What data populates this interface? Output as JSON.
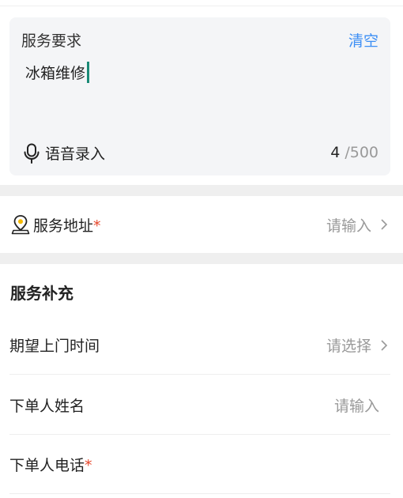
{
  "service_request": {
    "title": "服务要求",
    "clear_label": "清空",
    "text": "冰箱维修",
    "voice_label": "语音录入",
    "char_count": "4",
    "char_max": "/500"
  },
  "address": {
    "label": "服务地址",
    "required_mark": "*",
    "placeholder": "请输入"
  },
  "supplement": {
    "title": "服务补充",
    "visit_time_label": "期望上门时间",
    "visit_time_placeholder": "请选择",
    "name_label": "下单人姓名",
    "name_placeholder": "请输入",
    "phone_label": "下单人电话",
    "phone_required_mark": "*"
  },
  "colors": {
    "accent": "#3d8ff5",
    "required": "#e6462b",
    "caret": "#1a8a76"
  }
}
